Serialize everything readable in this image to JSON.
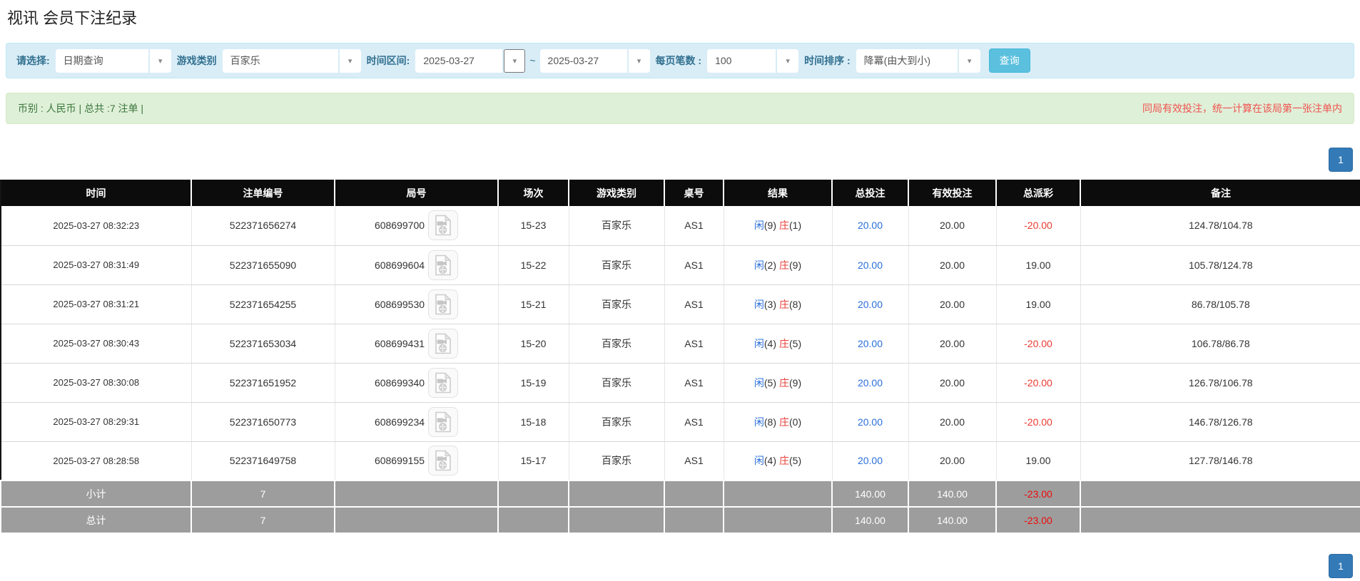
{
  "page": {
    "title": "视讯 会员下注纪录"
  },
  "filters": {
    "select_label": "请选择:",
    "select_value": "日期查询",
    "game_label": "游戏类别",
    "game_value": "百家乐",
    "range_label": "时间区间:",
    "date_from": "2025-03-27",
    "range_tilde": "~",
    "date_to": "2025-03-27",
    "per_page_label": "每页笔数 :",
    "per_page_value": "100",
    "sort_label": "时间排序 :",
    "sort_value": "降冪(由大到小)",
    "search_button": "查询"
  },
  "summary": {
    "left": "币别 : 人民币 | 总共 :7 注单 |",
    "right": "同局有效投注，统一计算在该局第一张注单内"
  },
  "pagination": {
    "current_page": "1"
  },
  "icons": {
    "dropdown_caret": "▾",
    "video_icon_name": "video-replay-file-icon"
  },
  "table": {
    "headers": [
      "时间",
      "注单编号",
      "局号",
      "场次",
      "游戏类别",
      "桌号",
      "结果",
      "总投注",
      "有效投注",
      "总派彩",
      "备注"
    ],
    "rows": [
      {
        "time": "2025-03-27 08:32:23",
        "bet_no": "522371656274",
        "round_no": "608699700",
        "session": "15-23",
        "game": "百家乐",
        "table_no": "AS1",
        "result_player": "闲(9)",
        "result_banker": "庄(1)",
        "total_bet": "20.00",
        "valid_bet": "20.00",
        "payout": "-20.00",
        "note": "124.78/104.78"
      },
      {
        "time": "2025-03-27 08:31:49",
        "bet_no": "522371655090",
        "round_no": "608699604",
        "session": "15-22",
        "game": "百家乐",
        "table_no": "AS1",
        "result_player": "闲(2)",
        "result_banker": "庄(9)",
        "total_bet": "20.00",
        "valid_bet": "20.00",
        "payout": "19.00",
        "note": "105.78/124.78"
      },
      {
        "time": "2025-03-27 08:31:21",
        "bet_no": "522371654255",
        "round_no": "608699530",
        "session": "15-21",
        "game": "百家乐",
        "table_no": "AS1",
        "result_player": "闲(3)",
        "result_banker": "庄(8)",
        "total_bet": "20.00",
        "valid_bet": "20.00",
        "payout": "19.00",
        "note": "86.78/105.78"
      },
      {
        "time": "2025-03-27 08:30:43",
        "bet_no": "522371653034",
        "round_no": "608699431",
        "session": "15-20",
        "game": "百家乐",
        "table_no": "AS1",
        "result_player": "闲(4)",
        "result_banker": "庄(5)",
        "total_bet": "20.00",
        "valid_bet": "20.00",
        "payout": "-20.00",
        "note": "106.78/86.78"
      },
      {
        "time": "2025-03-27 08:30:08",
        "bet_no": "522371651952",
        "round_no": "608699340",
        "session": "15-19",
        "game": "百家乐",
        "table_no": "AS1",
        "result_player": "闲(5)",
        "result_banker": "庄(9)",
        "total_bet": "20.00",
        "valid_bet": "20.00",
        "payout": "-20.00",
        "note": "126.78/106.78"
      },
      {
        "time": "2025-03-27 08:29:31",
        "bet_no": "522371650773",
        "round_no": "608699234",
        "session": "15-18",
        "game": "百家乐",
        "table_no": "AS1",
        "result_player": "闲(8)",
        "result_banker": "庄(0)",
        "total_bet": "20.00",
        "valid_bet": "20.00",
        "payout": "-20.00",
        "note": "146.78/126.78"
      },
      {
        "time": "2025-03-27 08:28:58",
        "bet_no": "522371649758",
        "round_no": "608699155",
        "session": "15-17",
        "game": "百家乐",
        "table_no": "AS1",
        "result_player": "闲(4)",
        "result_banker": "庄(5)",
        "total_bet": "20.00",
        "valid_bet": "20.00",
        "payout": "19.00",
        "note": "127.78/146.78"
      }
    ],
    "footer_rows": [
      {
        "label": "小计",
        "count": "7",
        "total_bet": "140.00",
        "valid_bet": "140.00",
        "payout": "-23.00"
      },
      {
        "label": "总计",
        "count": "7",
        "total_bet": "140.00",
        "valid_bet": "140.00",
        "payout": "-23.00"
      }
    ]
  },
  "colors": {
    "filter_bg": "#d9edf7",
    "filter_label": "#31708f",
    "search_button": "#5bc0de",
    "summary_bg": "#dff0d8",
    "summary_text_green": "#3c763d",
    "notice_red": "#f0524f",
    "header_bg": "#0c0c0c",
    "footer_bg": "#9d9d9d",
    "link_blue": "#2a6fdb",
    "negative_red": "#ea3a30",
    "pagination_active": "#337ab7"
  }
}
